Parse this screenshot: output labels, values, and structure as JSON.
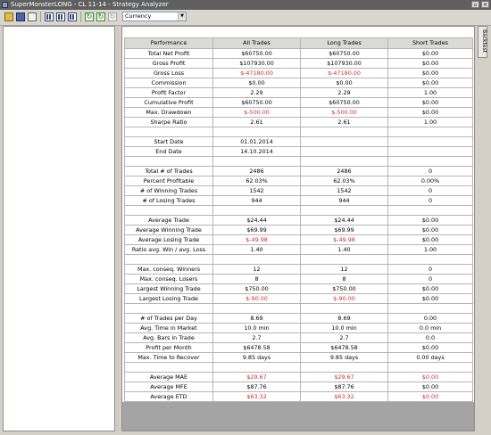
{
  "window": {
    "title": "SuperMonsterLONG - CL 11-14 - Strategy Analyzer"
  },
  "toolbar": {
    "currency_value": "Currency",
    "icons": [
      "open-folder-icon",
      "save-icon",
      "print-icon",
      "report-grid-icon",
      "report-grid-icon",
      "report-grid-icon",
      "refresh-icon",
      "refresh-icon",
      "refresh-icon"
    ]
  },
  "side_tab": {
    "label": "Backtest"
  },
  "table": {
    "headers": [
      "Performance",
      "All Trades",
      "Long Trades",
      "Short Trades"
    ],
    "rows": [
      [
        "Total Net Profit",
        "$60750.00",
        "$60750.00",
        "$0.00"
      ],
      [
        "Gross Profit",
        "$107930.00",
        "$107930.00",
        "$0.00"
      ],
      [
        "Gross Loss",
        "$-47180.00",
        "$-47180.00",
        "$0.00"
      ],
      [
        "Commission",
        "$0.00",
        "$0.00",
        "$0.00"
      ],
      [
        "Profit Factor",
        "2.29",
        "2.29",
        "1.00"
      ],
      [
        "Cumulative Profit",
        "$60750.00",
        "$60750.00",
        "$0.00"
      ],
      [
        "Max. Drawdown",
        "$-500.00",
        "$-500.00",
        "$0.00"
      ],
      [
        "Sharpe Ratio",
        "2.61",
        "2.61",
        "1.00"
      ],
      [
        "",
        "",
        "",
        ""
      ],
      [
        "Start Date",
        "01.01.2014",
        "",
        ""
      ],
      [
        "End Date",
        "14.10.2014",
        "",
        ""
      ],
      [
        "",
        "",
        "",
        ""
      ],
      [
        "Total # of Trades",
        "2486",
        "2486",
        "0"
      ],
      [
        "Percent Profitable",
        "62.03%",
        "62.03%",
        "0.00%"
      ],
      [
        "# of Winning Trades",
        "1542",
        "1542",
        "0"
      ],
      [
        "# of Losing Trades",
        "944",
        "944",
        "0"
      ],
      [
        "",
        "",
        "",
        ""
      ],
      [
        "Average Trade",
        "$24.44",
        "$24.44",
        "$0.00"
      ],
      [
        "Average Winning Trade",
        "$69.99",
        "$69.99",
        "$0.00"
      ],
      [
        "Average Losing Trade",
        "$-49.98",
        "$-49.98",
        "$0.00"
      ],
      [
        "Ratio avg. Win / avg. Loss",
        "1.40",
        "1.40",
        "1.00"
      ],
      [
        "",
        "",
        "",
        ""
      ],
      [
        "Max. conseq. Winners",
        "12",
        "12",
        "0"
      ],
      [
        "Max. conseq. Losers",
        "8",
        "8",
        "0"
      ],
      [
        "Largest Winning Trade",
        "$750.00",
        "$750.00",
        "$0.00"
      ],
      [
        "Largest Losing Trade",
        "$-90.00",
        "$-90.00",
        "$0.00"
      ],
      [
        "",
        "",
        "",
        ""
      ],
      [
        "# of Trades per Day",
        "8.69",
        "8.69",
        "0.00"
      ],
      [
        "Avg. Time in Market",
        "10.0 min",
        "10.0 min",
        "0.0 min"
      ],
      [
        "Avg. Bars in Trade",
        "2.7",
        "2.7",
        "0.0"
      ],
      [
        "Profit per Month",
        "$6478.58",
        "$6478.58",
        "$0.00"
      ],
      [
        "Max. Time to Recover",
        "9.85 days",
        "9.85 days",
        "0.00 days"
      ],
      [
        "",
        "",
        "",
        ""
      ],
      [
        "Average MAE",
        "$29.67",
        "$29.67",
        "$0.00"
      ],
      [
        "Average MFE",
        "$87.76",
        "$87.76",
        "$0.00"
      ],
      [
        "Average ETD",
        "$63.32",
        "$63.32",
        "$0.00"
      ]
    ],
    "red_cells": [
      [
        2,
        1
      ],
      [
        2,
        2
      ],
      [
        6,
        1
      ],
      [
        6,
        2
      ],
      [
        19,
        1
      ],
      [
        19,
        2
      ],
      [
        25,
        1
      ],
      [
        25,
        2
      ],
      [
        33,
        1
      ],
      [
        33,
        2
      ],
      [
        33,
        3
      ],
      [
        35,
        1
      ],
      [
        35,
        2
      ],
      [
        35,
        3
      ]
    ]
  },
  "colors": {
    "negative": "#d52a2a",
    "header_bg": "#dcdad5",
    "empty_area": "#a4a4a4"
  }
}
